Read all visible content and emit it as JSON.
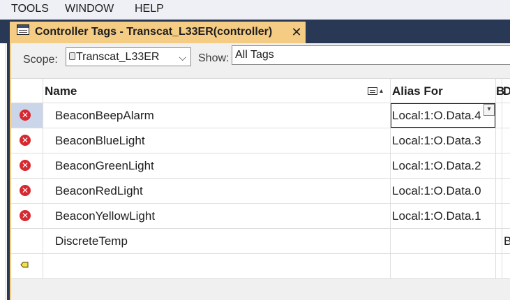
{
  "menu": {
    "items": [
      "TOOLS",
      "WINDOW",
      "HELP"
    ]
  },
  "tab": {
    "title": "Controller Tags - Transcat_L33ER(controller)",
    "close": "✕"
  },
  "toolbar": {
    "scope_label": "Scope:",
    "scope_value": "Transcat_L33ER",
    "scope_chevron": "⌵",
    "show_label": "Show:",
    "show_value": "All Tags"
  },
  "grid": {
    "columns": {
      "name": "Name",
      "alias_for": "Alias For",
      "b": "B",
      "d": "D"
    },
    "sort_arrow": "▴",
    "error_glyph": "✕",
    "dropdown_glyph": "▾",
    "rows": [
      {
        "name": "BeaconBeepAlarm",
        "alias_for": "Local:1:O.Data.4",
        "b": "",
        "status": "error",
        "selected": true
      },
      {
        "name": "BeaconBlueLight",
        "alias_for": "Local:1:O.Data.3",
        "b": "",
        "status": "error"
      },
      {
        "name": "BeaconGreenLight",
        "alias_for": "Local:1:O.Data.2",
        "b": "",
        "status": "error"
      },
      {
        "name": "BeaconRedLight",
        "alias_for": "Local:1:O.Data.0",
        "b": "",
        "status": "error"
      },
      {
        "name": "BeaconYellowLight",
        "alias_for": "Local:1:O.Data.1",
        "b": "",
        "status": "error"
      },
      {
        "name": "DiscreteTemp",
        "alias_for": "",
        "b": "B",
        "status": "ok"
      }
    ]
  },
  "colors": {
    "frame": "#293955",
    "tab_active": "#f5cc84",
    "error": "#d7282f",
    "selected_row": "#cbd5ea"
  },
  "icons": {
    "tab": "tag-table-icon",
    "scope": "controller-icon",
    "error": "error-icon",
    "new_row": "new-row-tag-icon",
    "sort": "column-chooser-icon"
  }
}
